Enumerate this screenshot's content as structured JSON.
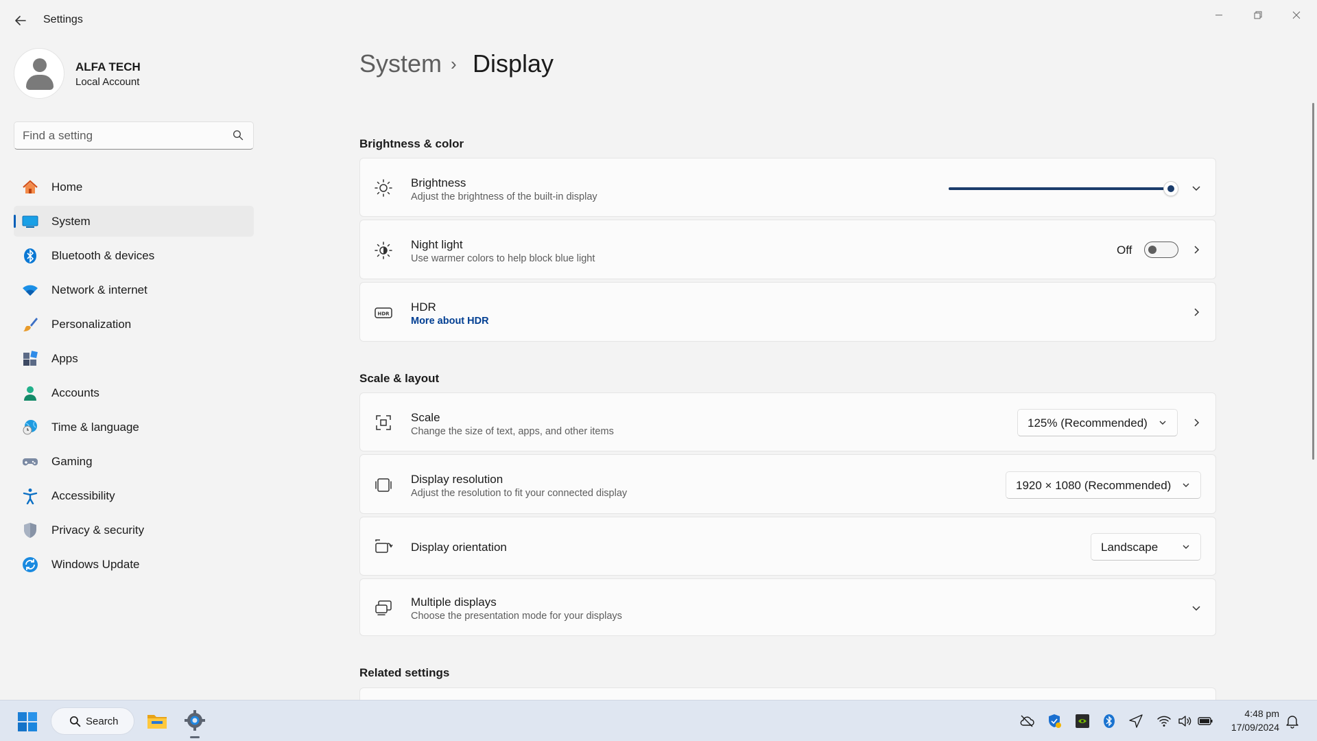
{
  "window": {
    "title": "Settings"
  },
  "profile": {
    "name": "ALFA TECH",
    "account_type": "Local Account"
  },
  "search": {
    "placeholder": "Find a setting"
  },
  "sidebar": {
    "items": [
      {
        "label": "Home",
        "icon": "home-icon"
      },
      {
        "label": "System",
        "icon": "system-icon",
        "active": true
      },
      {
        "label": "Bluetooth & devices",
        "icon": "bluetooth-icon"
      },
      {
        "label": "Network & internet",
        "icon": "wifi-icon"
      },
      {
        "label": "Personalization",
        "icon": "brush-icon"
      },
      {
        "label": "Apps",
        "icon": "apps-icon"
      },
      {
        "label": "Accounts",
        "icon": "accounts-icon"
      },
      {
        "label": "Time & language",
        "icon": "globe-clock-icon"
      },
      {
        "label": "Gaming",
        "icon": "gamepad-icon"
      },
      {
        "label": "Accessibility",
        "icon": "accessibility-icon"
      },
      {
        "label": "Privacy & security",
        "icon": "shield-icon"
      },
      {
        "label": "Windows Update",
        "icon": "update-icon"
      }
    ]
  },
  "breadcrumb": {
    "parent": "System",
    "separator": "›",
    "current": "Display"
  },
  "sections": {
    "brightness_color": {
      "title": "Brightness & color",
      "brightness": {
        "title": "Brightness",
        "subtitle": "Adjust the brightness of the built-in display",
        "value_fraction": 1.0
      },
      "night_light": {
        "title": "Night light",
        "subtitle": "Use warmer colors to help block blue light",
        "state_label": "Off",
        "on": false
      },
      "hdr": {
        "title": "HDR",
        "link": "More about HDR"
      }
    },
    "scale_layout": {
      "title": "Scale & layout",
      "scale": {
        "title": "Scale",
        "subtitle": "Change the size of text, apps, and other items",
        "value": "125% (Recommended)"
      },
      "resolution": {
        "title": "Display resolution",
        "subtitle": "Adjust the resolution to fit your connected display",
        "value": "1920 × 1080 (Recommended)"
      },
      "orientation": {
        "title": "Display orientation",
        "value": "Landscape"
      },
      "multiple_displays": {
        "title": "Multiple displays",
        "subtitle": "Choose the presentation mode for your displays"
      }
    },
    "related": {
      "title": "Related settings"
    }
  },
  "taskbar": {
    "search_label": "Search",
    "time": "4:48 pm",
    "date": "17/09/2024"
  },
  "colors": {
    "accent": "#005fb8",
    "slider": "#1b3c6b",
    "link": "#003e92",
    "background": "#f3f3f3",
    "card": "#fbfbfb"
  }
}
